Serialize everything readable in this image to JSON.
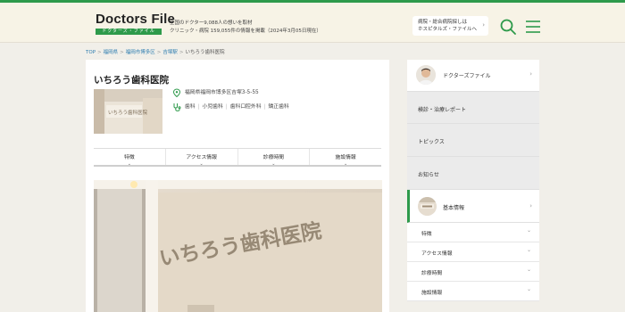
{
  "header": {
    "logo_main": "Doctors File",
    "logo_sub": "ドクターズ・ファイル",
    "tagline_1": "全国のドクター9,088人の想いを取材",
    "tagline_2": "クリニック・病院 159,055件の情報を掲載（2024年3月05日現在）",
    "hospital_link_1": "病院・総合病院探しは",
    "hospital_link_2": "ホスピタルズ・ファイルへ"
  },
  "breadcrumb": {
    "items": [
      "TOP",
      "福岡県",
      "福岡市博多区",
      "吉塚駅",
      "いちろう歯科医院"
    ],
    "separator": ">"
  },
  "clinic": {
    "name": "いちろう歯科医院",
    "address": "福岡県福岡市博多区吉塚3-5-55",
    "departments": [
      "歯科",
      "小児歯科",
      "歯科口腔外科",
      "矯正歯科"
    ],
    "thumb_sign": "いちろう歯科医院"
  },
  "tabs": [
    "特徴",
    "アクセス情報",
    "診療時間",
    "施設情報"
  ],
  "hero": {
    "sign_text": "いちろう歯科医院"
  },
  "sidebar": {
    "items": [
      "ドクターズファイル",
      "検診・治療レポート",
      "トピックス",
      "お知らせ",
      "基本情報"
    ],
    "sub_items": [
      "特徴",
      "アクセス情報",
      "診療時間",
      "施設情報"
    ]
  },
  "colors": {
    "brand_green": "#2e9a4b",
    "header_bg": "#f7f3e6",
    "page_bg": "#f1efe9",
    "link_blue": "#2e7db0"
  }
}
